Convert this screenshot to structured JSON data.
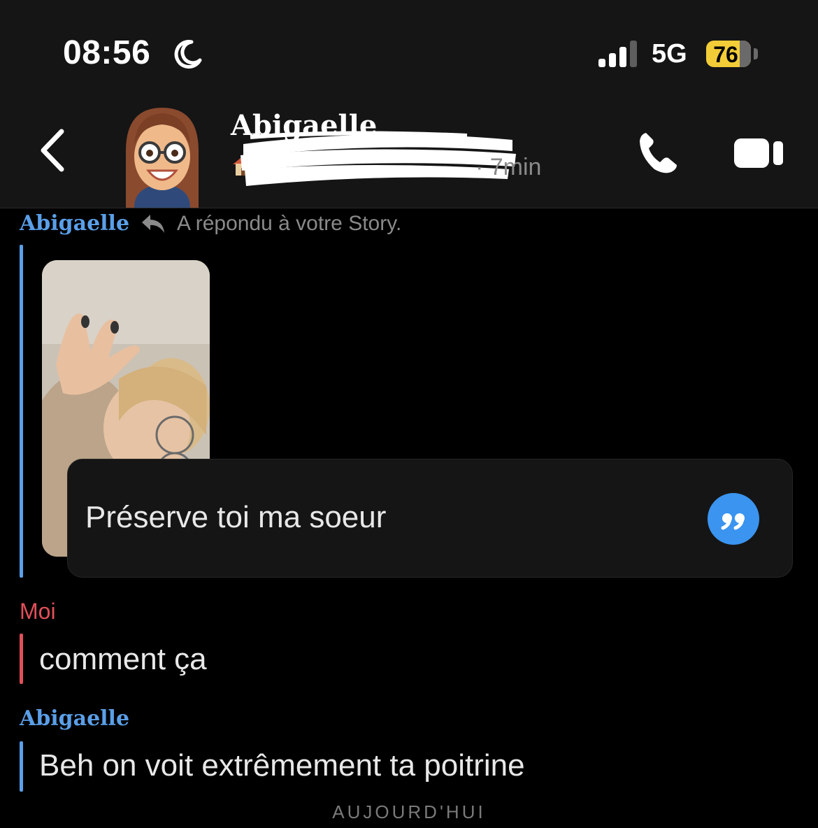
{
  "status_bar": {
    "time": "08:56",
    "network": "5G",
    "battery": "76",
    "battery_color": "#f2cd37",
    "icons": [
      "moon-icon",
      "signal-icon",
      "battery-icon"
    ]
  },
  "header": {
    "contact_name": "Abigaelle",
    "last_seen": "· 7min",
    "icons": [
      "back-icon",
      "avatar",
      "home-icon",
      "phone-icon",
      "video-icon"
    ]
  },
  "conversation": {
    "story_reply": {
      "sender": "Abigaelle",
      "note": "A répondu à votre Story.",
      "quote": "Préserve toi ma soeur"
    },
    "messages": [
      {
        "sender": "Moi",
        "text": "comment ça"
      },
      {
        "sender": "Abigaelle",
        "text": "Beh on voit extrêmement ta poitrine"
      }
    ],
    "day_divider": "AUJOURD'HUI"
  },
  "colors": {
    "contact_blue": "#5a9fe8",
    "me_red": "#e0505a",
    "quote_blue": "#3a94f0",
    "background": "#000000"
  }
}
